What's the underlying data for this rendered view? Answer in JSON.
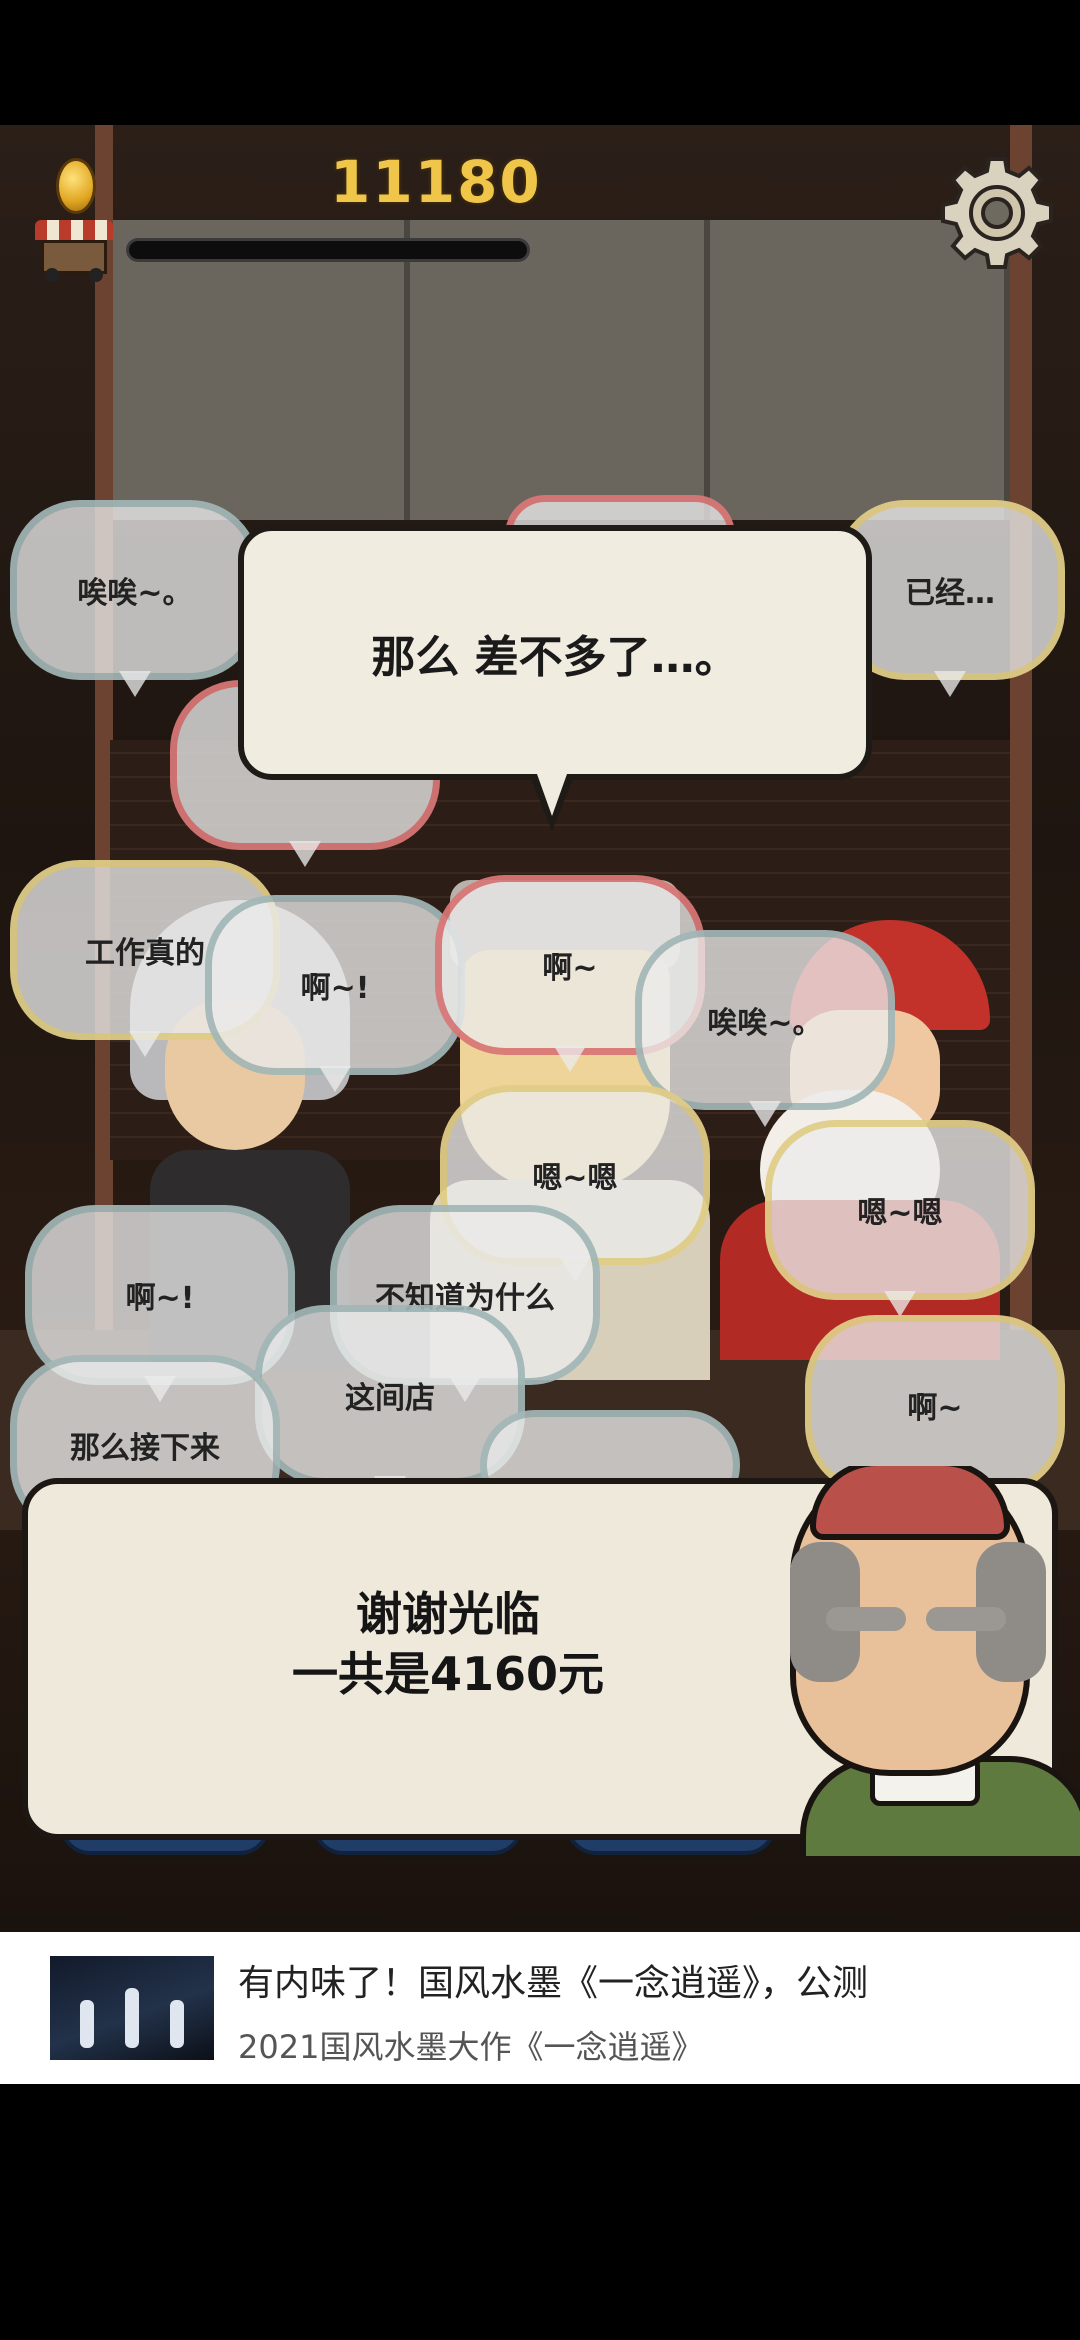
{
  "hud": {
    "coins": "11180",
    "progress": 0.0,
    "settings_icon": "gear-icon",
    "shop_icon": "food-cart-icon",
    "coin_icon": "gold-coin-icon"
  },
  "main_speech": "那么 差不多了…。",
  "bubbles": [
    "唉唉~。",
    "已经…",
    "工作真的",
    "啊~!",
    "啊~",
    "唉唉~。",
    "嗯~嗯",
    "嗯~嗯",
    "啊~!",
    "不知道为什么",
    "这间店",
    "那么接下来",
    "啊~"
  ],
  "dialog": {
    "line1": "谢谢光临",
    "line2": "一共是4160元"
  },
  "ad": {
    "title": "有内味了！国风水墨《一念逍遥》，公测",
    "subtitle": "2021国风水墨大作《一念逍遥》"
  },
  "colors": {
    "coin_text": "#f0c64a",
    "dialog_bg": "#efe9db",
    "menu_tab": "#1f3d66"
  }
}
